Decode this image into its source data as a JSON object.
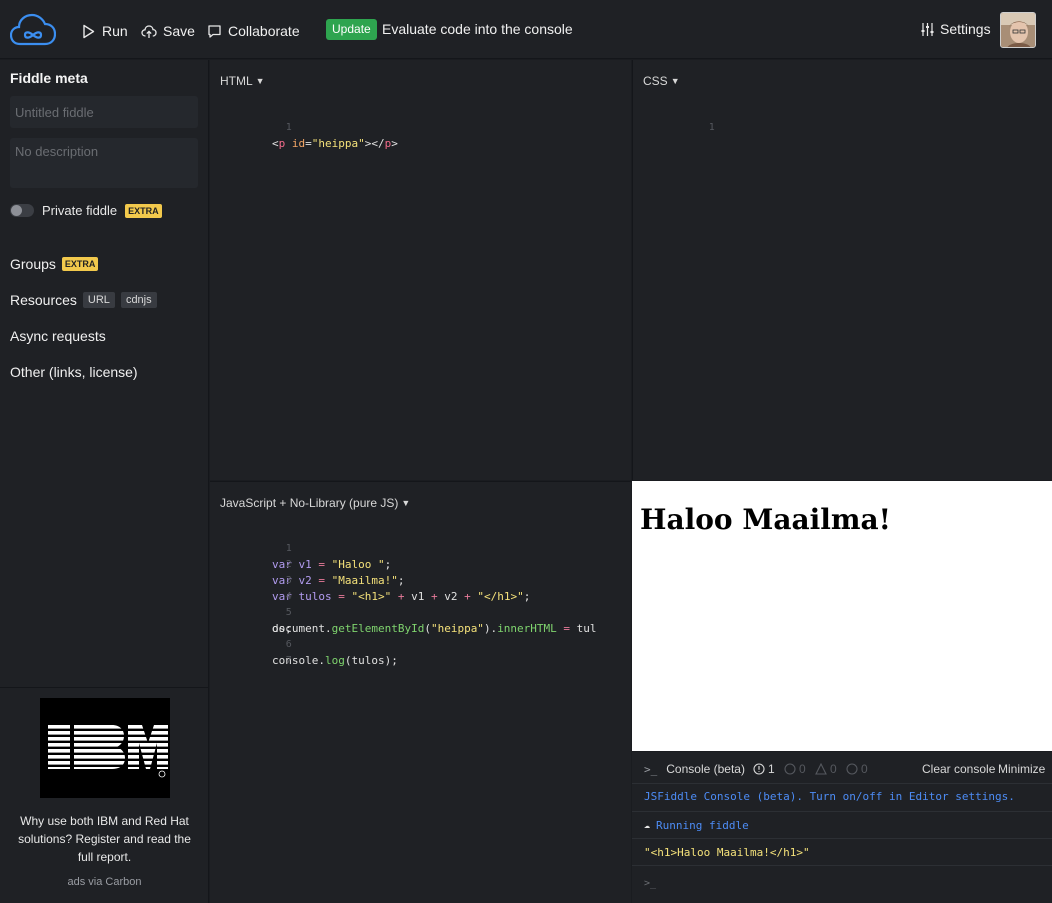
{
  "topbar": {
    "run_label": "Run",
    "save_label": "Save",
    "collaborate_label": "Collaborate",
    "update_badge": "Update",
    "update_text": "Evaluate code into the console",
    "settings_label": "Settings"
  },
  "sidebar": {
    "title": "Fiddle meta",
    "fiddle_name_placeholder": "Untitled fiddle",
    "description_placeholder": "No description",
    "private_label": "Private fiddle",
    "extra_badge": "EXTRA",
    "groups_label": "Groups",
    "resources_label": "Resources",
    "url_badge": "URL",
    "cdnjs_badge": "cdnjs",
    "async_label": "Async requests",
    "other_label": "Other (links, license)"
  },
  "ad": {
    "brand": "IBM",
    "text": "Why use both IBM and Red Hat solutions? Register and read the full report.",
    "via": "ads via Carbon"
  },
  "panels": {
    "html_label": "HTML",
    "css_label": "CSS",
    "js_label": "JavaScript + No-Library (pure JS)"
  },
  "html_code": {
    "line_numbers": [
      "1"
    ]
  },
  "css_code": {
    "line_numbers": [
      "1"
    ]
  },
  "js_code": {
    "line_numbers": [
      "1",
      "2",
      "3",
      "4",
      "5",
      "",
      "6",
      "7"
    ]
  },
  "result": {
    "heading": "Haloo Maailma!"
  },
  "console": {
    "title": "Console (beta)",
    "errors_count": "1",
    "warn_count": "0",
    "alert_count": "0",
    "info_count": "0",
    "clear_label": "Clear console",
    "minimize_label": "Minimize",
    "info_message": "JSFiddle Console (beta). Turn on/off in Editor settings.",
    "running_message": "Running fiddle",
    "log_output": "\"<h1>Haloo Maailma!</h1>\"",
    "prompt": ">_"
  },
  "colors": {
    "background": "#1a1c20",
    "panel": "#1f2125",
    "update_green": "#2ea44f",
    "extra_yellow": "#f2c94c",
    "console_blue": "#4d8cf5",
    "logo_blue": "#3b8ef0"
  },
  "icons": {
    "logo": "jsfiddle-cloud-logo",
    "run": "play-icon",
    "save": "cloud-upload-icon",
    "collaborate": "chat-bubble-icon",
    "settings": "sliders-icon"
  }
}
